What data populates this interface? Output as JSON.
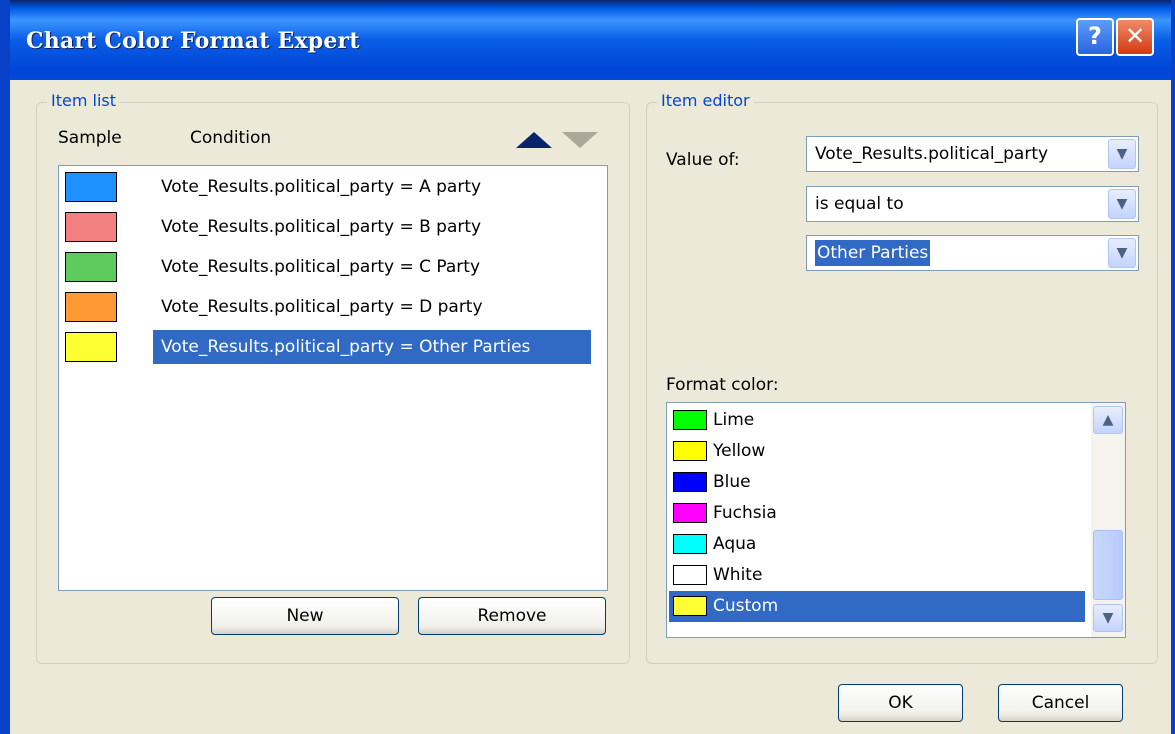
{
  "window": {
    "title": "Chart Color Format Expert",
    "help_label": "?",
    "close_label": "✕"
  },
  "item_list": {
    "group_title": "Item list",
    "col_sample": "Sample",
    "col_condition": "Condition",
    "items": [
      {
        "condition": "Vote_Results.political_party = A party",
        "color": "#1e90ff"
      },
      {
        "condition": "Vote_Results.political_party = B party",
        "color": "#f28080"
      },
      {
        "condition": "Vote_Results.political_party = C Party",
        "color": "#5ecb5e"
      },
      {
        "condition": "Vote_Results.political_party = D party",
        "color": "#ff9933"
      },
      {
        "condition": "Vote_Results.political_party = Other Parties",
        "color": "#ffff33"
      }
    ],
    "selected_index": 4,
    "new_label": "New",
    "remove_label": "Remove"
  },
  "item_editor": {
    "group_title": "Item editor",
    "value_of_label": "Value of:",
    "field_value": "Vote_Results.political_party",
    "operator_value": "is equal to",
    "compare_value": "Other Parties",
    "format_color_label": "Format color:",
    "colors": [
      {
        "name": "Lime",
        "color": "#00ff00"
      },
      {
        "name": "Yellow",
        "color": "#ffff00"
      },
      {
        "name": "Blue",
        "color": "#0000ff"
      },
      {
        "name": "Fuchsia",
        "color": "#ff00ff"
      },
      {
        "name": "Aqua",
        "color": "#00ffff"
      },
      {
        "name": "White",
        "color": "#ffffff"
      },
      {
        "name": "Custom",
        "color": "#ffff33"
      }
    ],
    "selected_color_index": 6
  },
  "footer": {
    "ok_label": "OK",
    "cancel_label": "Cancel"
  }
}
